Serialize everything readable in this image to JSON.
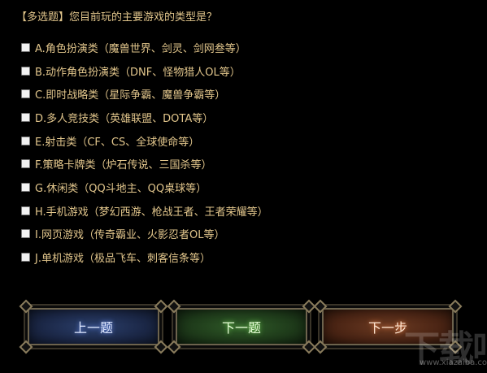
{
  "question": {
    "title": "【多选题】您目前玩的主要游戏的类型是？"
  },
  "options": [
    {
      "label": "A.角色扮演类（魔兽世界、剑灵、剑网叁等）",
      "checked": false
    },
    {
      "label": "B.动作角色扮演类（DNF、怪物猎人OL等）",
      "checked": false
    },
    {
      "label": "C.即时战略类（星际争霸、魔兽争霸等）",
      "checked": false
    },
    {
      "label": "D.多人竞技类（英雄联盟、DOTA等）",
      "checked": false
    },
    {
      "label": "E.射击类（CF、CS、全球使命等）",
      "checked": false
    },
    {
      "label": "F.策略卡牌类（炉石传说、三国杀等）",
      "checked": false
    },
    {
      "label": "G.休闲类（QQ斗地主、QQ桌球等）",
      "checked": false
    },
    {
      "label": "H.手机游戏（梦幻西游、枪战王者、王者荣耀等）",
      "checked": false
    },
    {
      "label": "I.网页游戏（传奇霸业、火影忍者OL等）",
      "checked": false
    },
    {
      "label": "J.单机游戏（极品飞车、刺客信条等）",
      "checked": false
    }
  ],
  "buttons": {
    "prev_label": "上一题",
    "next_label": "下一题",
    "step_label": "下一步"
  },
  "watermark": {
    "logo": "下载吧",
    "url": "www.xiazaiba.com"
  },
  "colors": {
    "background": "#000000",
    "text": "#e2c68c",
    "prev_button": "#1b2746",
    "next_button": "#1e3a1a",
    "step_button": "#4a2414"
  }
}
